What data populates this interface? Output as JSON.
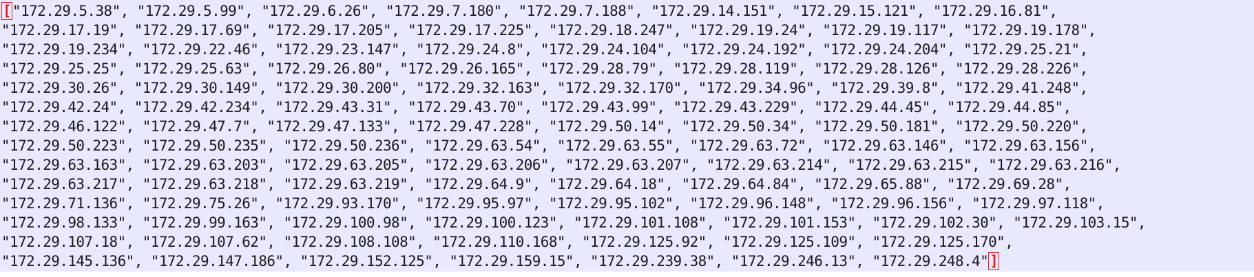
{
  "colors": {
    "background": "#e8e8ff",
    "text": "#1a1a1a",
    "bracket": "#e02020"
  },
  "editor": {
    "open_bracket": "[",
    "close_bracket": "]",
    "lines": [
      "\"172.29.5.38\", \"172.29.5.99\", \"172.29.6.26\", \"172.29.7.180\", \"172.29.7.188\", \"172.29.14.151\", \"172.29.15.121\", \"172.29.16.81\",",
      "\"172.29.17.19\", \"172.29.17.69\", \"172.29.17.205\", \"172.29.17.225\", \"172.29.18.247\", \"172.29.19.24\", \"172.29.19.117\", \"172.29.19.178\",",
      "\"172.29.19.234\", \"172.29.22.46\", \"172.29.23.147\", \"172.29.24.8\", \"172.29.24.104\", \"172.29.24.192\", \"172.29.24.204\", \"172.29.25.21\",",
      "\"172.29.25.25\", \"172.29.25.63\", \"172.29.26.80\", \"172.29.26.165\", \"172.29.28.79\", \"172.29.28.119\", \"172.29.28.126\", \"172.29.28.226\",",
      "\"172.29.30.26\", \"172.29.30.149\", \"172.29.30.200\", \"172.29.32.163\", \"172.29.32.170\", \"172.29.34.96\", \"172.29.39.8\", \"172.29.41.248\",",
      "\"172.29.42.24\", \"172.29.42.234\", \"172.29.43.31\", \"172.29.43.70\", \"172.29.43.99\", \"172.29.43.229\", \"172.29.44.45\", \"172.29.44.85\",",
      "\"172.29.46.122\", \"172.29.47.7\", \"172.29.47.133\", \"172.29.47.228\", \"172.29.50.14\", \"172.29.50.34\", \"172.29.50.181\", \"172.29.50.220\",",
      "\"172.29.50.223\", \"172.29.50.235\", \"172.29.50.236\", \"172.29.63.54\", \"172.29.63.55\", \"172.29.63.72\", \"172.29.63.146\", \"172.29.63.156\",",
      "\"172.29.63.163\", \"172.29.63.203\", \"172.29.63.205\", \"172.29.63.206\", \"172.29.63.207\", \"172.29.63.214\", \"172.29.63.215\", \"172.29.63.216\",",
      "\"172.29.63.217\", \"172.29.63.218\", \"172.29.63.219\", \"172.29.64.9\", \"172.29.64.18\", \"172.29.64.84\", \"172.29.65.88\", \"172.29.69.28\",",
      "\"172.29.71.136\", \"172.29.75.26\", \"172.29.93.170\", \"172.29.95.97\", \"172.29.95.102\", \"172.29.96.148\", \"172.29.96.156\", \"172.29.97.118\",",
      "\"172.29.98.133\", \"172.29.99.163\", \"172.29.100.98\", \"172.29.100.123\", \"172.29.101.108\", \"172.29.101.153\", \"172.29.102.30\", \"172.29.103.15\",",
      "\"172.29.107.18\", \"172.29.107.62\", \"172.29.108.108\", \"172.29.110.168\", \"172.29.125.92\", \"172.29.125.109\", \"172.29.125.170\",",
      "\"172.29.145.136\", \"172.29.147.186\", \"172.29.152.125\", \"172.29.159.15\", \"172.29.239.38\", \"172.29.246.13\", \"172.29.248.4\""
    ]
  }
}
